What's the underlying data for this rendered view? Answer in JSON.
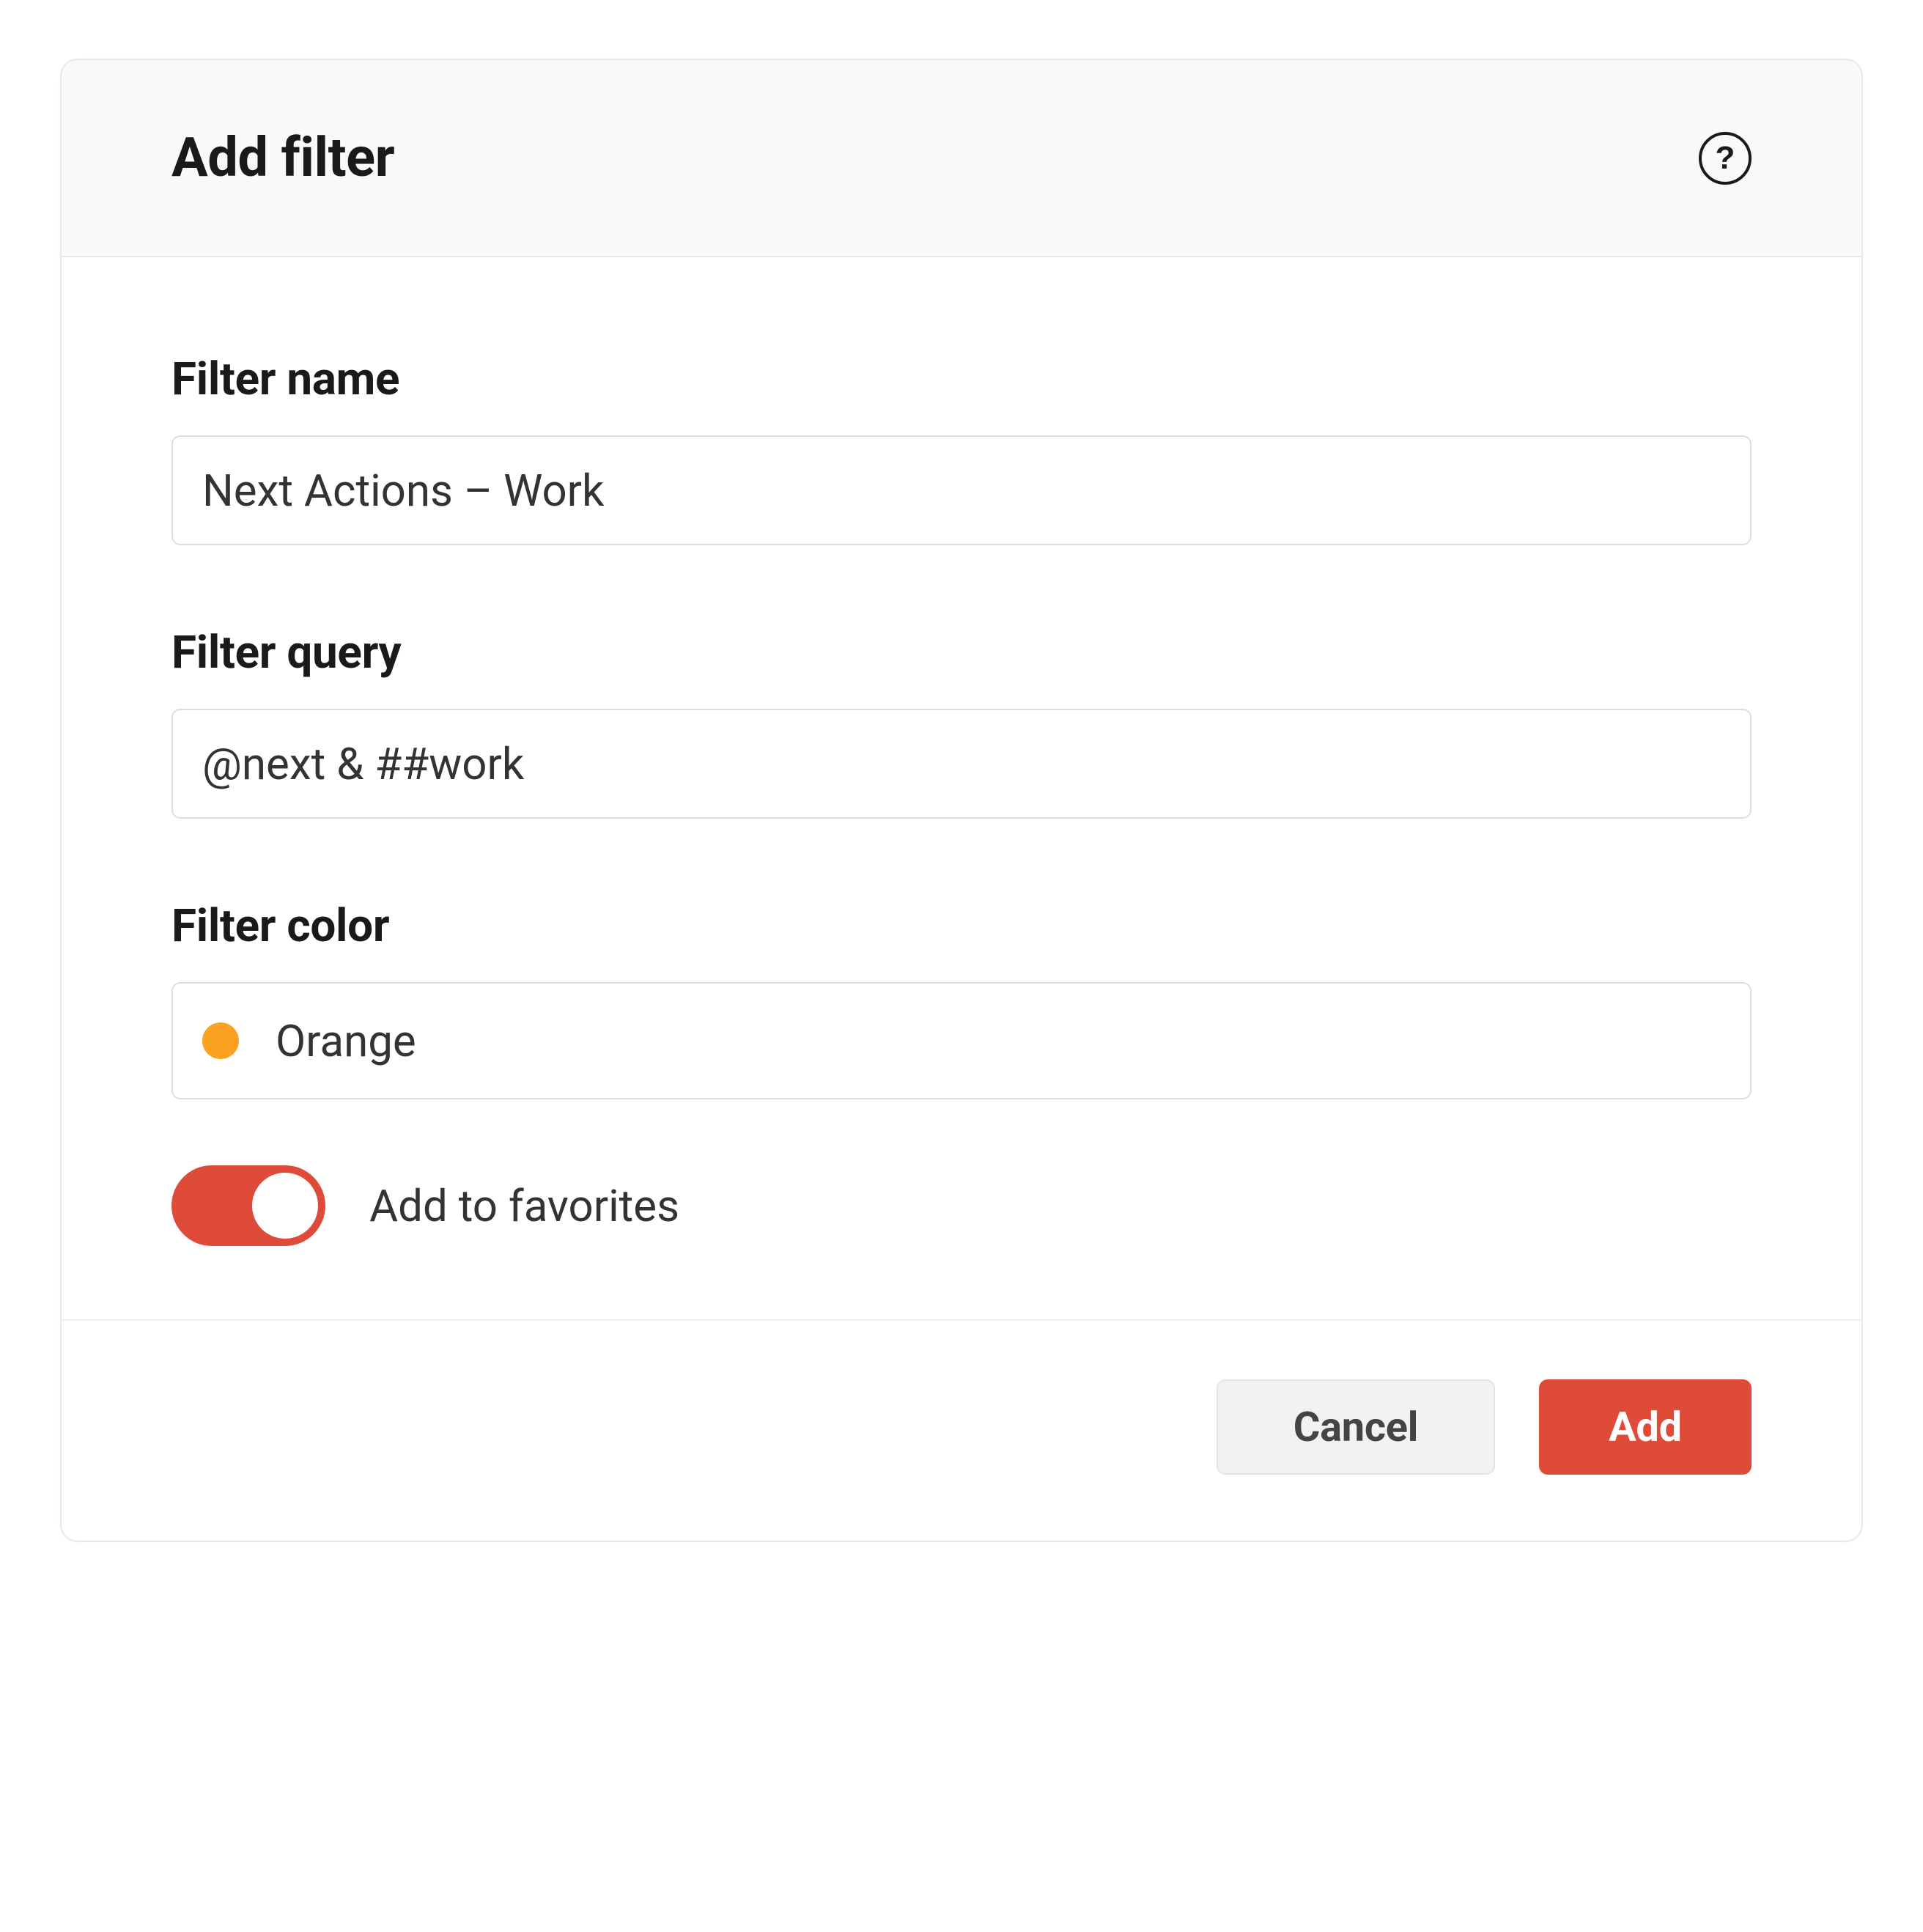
{
  "dialog": {
    "title": "Add filter"
  },
  "form": {
    "name_label": "Filter name",
    "name_value": "Next Actions – Work",
    "query_label": "Filter query",
    "query_value": "@next & ##work",
    "color_label": "Filter color",
    "color_selected": "Orange",
    "color_swatch_hex": "#fba220",
    "favorites_label": "Add to favorites",
    "favorites_on": true
  },
  "actions": {
    "cancel": "Cancel",
    "add": "Add"
  },
  "colors": {
    "accent": "#de4c39"
  }
}
